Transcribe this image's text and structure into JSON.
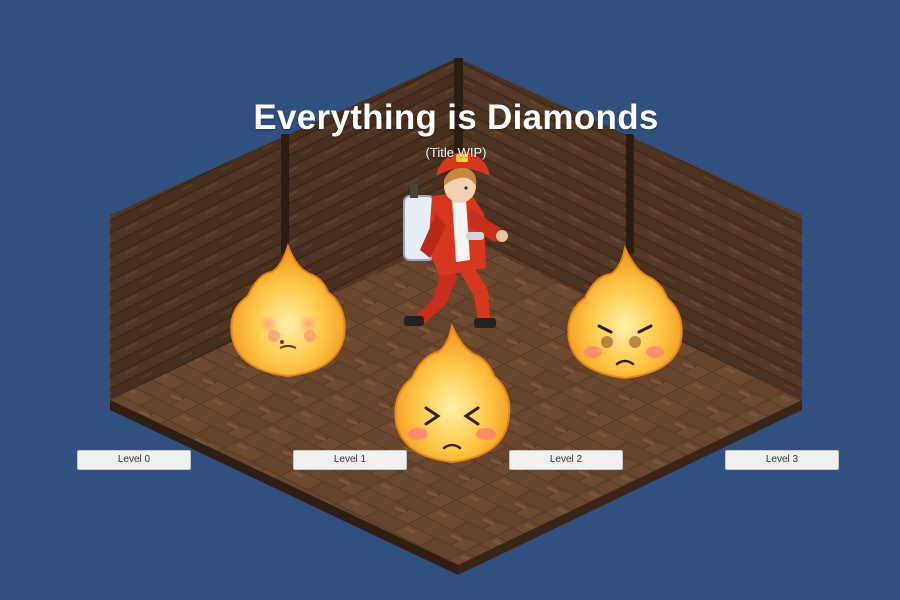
{
  "game": {
    "title": "Everything is Diamonds",
    "subtitle": "(Title WIP)"
  },
  "buttons": [
    {
      "label": "Level 0"
    },
    {
      "label": "Level 1"
    },
    {
      "label": "Level 2"
    },
    {
      "label": "Level 3"
    }
  ],
  "colors": {
    "background": "#30507f",
    "wood_dark": "#3a2618",
    "wood_mid": "#5a3d28",
    "wood_light": "#7a563a",
    "fire_outer": "#f5a623",
    "fire_inner": "#ffe27a",
    "button_bg": "#f0f0f0"
  },
  "sprites": {
    "player": "firefighter-character-icon",
    "enemies": [
      "fire-spirit-icon",
      "fire-spirit-icon",
      "fire-spirit-icon"
    ]
  }
}
